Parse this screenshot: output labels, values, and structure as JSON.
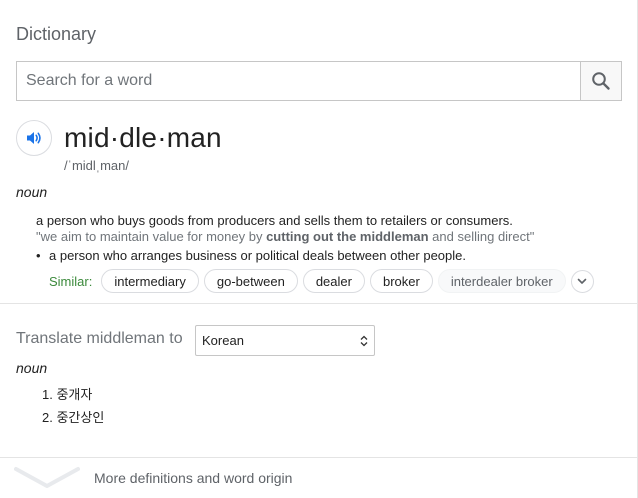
{
  "title": "Dictionary",
  "search": {
    "placeholder": "Search for a word"
  },
  "entry": {
    "headword": "mid·dle·man",
    "phonetic": "/ˈmidlˌman/",
    "part_of_speech": "noun",
    "definition_1": "a person who buys goods from producers and sells them to retailers or consumers.",
    "example_prefix": "\"we aim to maintain value for money by ",
    "example_bold": "cutting out the middleman",
    "example_suffix": " and selling direct\"",
    "definition_2": "a person who arranges business or political deals between other people.",
    "similar_label": "Similar:",
    "similar": [
      "intermediary",
      "go-between",
      "dealer",
      "broker",
      "interdealer broker"
    ]
  },
  "translate": {
    "label": "Translate middleman to",
    "language": "Korean",
    "part_of_speech": "noun",
    "items": [
      "1. 중개자",
      "2. 중간상인"
    ]
  },
  "footer": {
    "more_label": "More definitions and word origin"
  },
  "colors": {
    "accent": "#1a73e8",
    "similar_green": "#3c8a3c"
  },
  "icons": [
    "search-icon",
    "speaker-icon",
    "chevron-down-icon",
    "select-arrows-icon",
    "expand-chevron-icon"
  ]
}
